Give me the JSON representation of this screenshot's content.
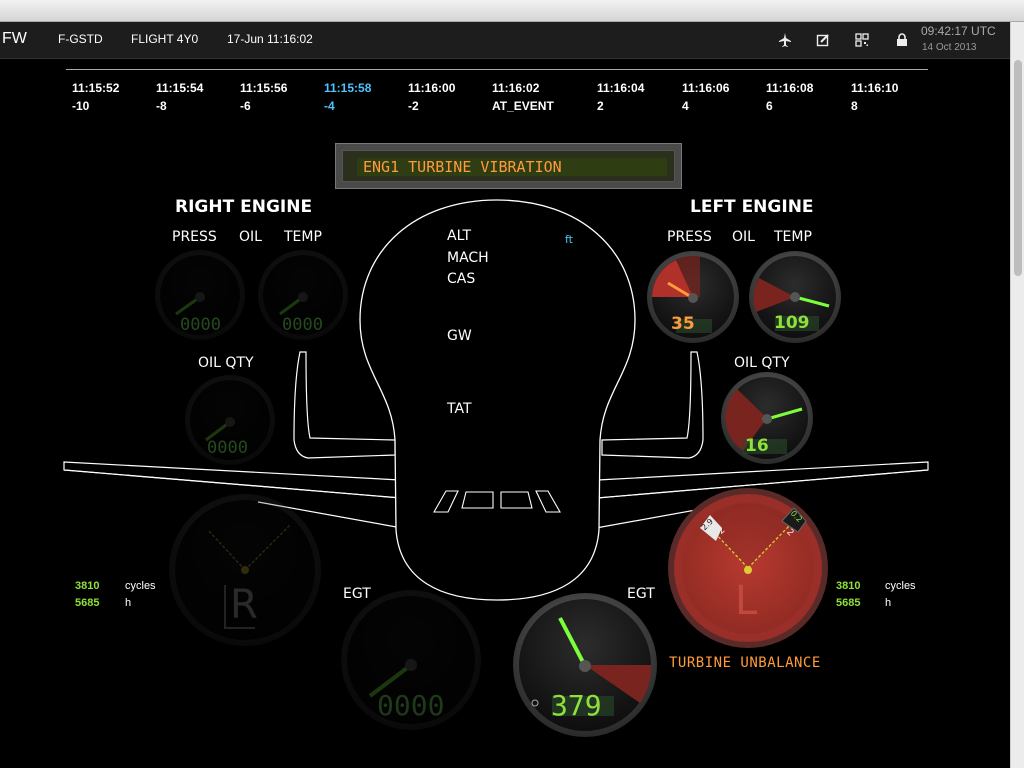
{
  "header": {
    "brand": "FW",
    "aircraft": "F-GSTD",
    "flight": "FLIGHT 4Y0",
    "datetime": "17-Jun 11:16:02",
    "clock_time": "09:42:17 UTC",
    "clock_date": "14 Oct 2013",
    "icons": [
      "airplane-icon",
      "edit-icon",
      "qr-code-icon",
      "lock-icon"
    ]
  },
  "timeline": [
    {
      "time": "11:15:52",
      "offset": "-10"
    },
    {
      "time": "11:15:54",
      "offset": "-8"
    },
    {
      "time": "11:15:56",
      "offset": "-6"
    },
    {
      "time": "11:15:58",
      "offset": "-4",
      "active": true
    },
    {
      "time": "11:16:00",
      "offset": "-2"
    },
    {
      "time": "11:16:02",
      "offset": "AT_EVENT"
    },
    {
      "time": "11:16:04",
      "offset": "2"
    },
    {
      "time": "11:16:06",
      "offset": "4"
    },
    {
      "time": "11:16:08",
      "offset": "6"
    },
    {
      "time": "11:16:10",
      "offset": "8"
    }
  ],
  "alert": "ENG1 TURBINE VIBRATION",
  "fuselage": {
    "alt": "ALT",
    "alt_unit": "ft",
    "mach": "MACH",
    "cas": "CAS",
    "gw": "GW",
    "tat": "TAT"
  },
  "right_engine": {
    "title": "RIGHT ENGINE",
    "press": "PRESS",
    "oil": "OIL",
    "temp": "TEMP",
    "oil_qty_label": "OIL QTY",
    "oil_press_value": "0000",
    "oil_temp_value": "0000",
    "oil_qty_value": "0000",
    "egt_label": "EGT",
    "egt_value": "0000",
    "vib_letter": "R",
    "cycles": "3810",
    "cycles_unit": "cycles",
    "hours": "5685",
    "hours_unit": "h"
  },
  "left_engine": {
    "title": "LEFT ENGINE",
    "press": "PRESS",
    "oil": "OIL",
    "temp": "TEMP",
    "oil_qty_label": "OIL QTY",
    "oil_press_value": "35",
    "oil_temp_value": "109",
    "oil_qty_value": "16",
    "egt_label": "EGT",
    "egt_value": "379",
    "vib_letter": "L",
    "vib_status": "TURBINE UNBALANCE",
    "vib_marker_left": "2.9",
    "vib_marker_left_mark": "2",
    "vib_marker_right": "0.2",
    "vib_marker_right_mark": "2",
    "cycles": "3810",
    "cycles_unit": "cycles",
    "hours": "5685",
    "hours_unit": "h"
  },
  "colors": {
    "accent_orange": "#ff9b3a",
    "value_green": "#8fe03a",
    "needle_green": "#7cff3a",
    "warning_red": "#b0302a",
    "highlight_cyan": "#4fc3ff"
  }
}
